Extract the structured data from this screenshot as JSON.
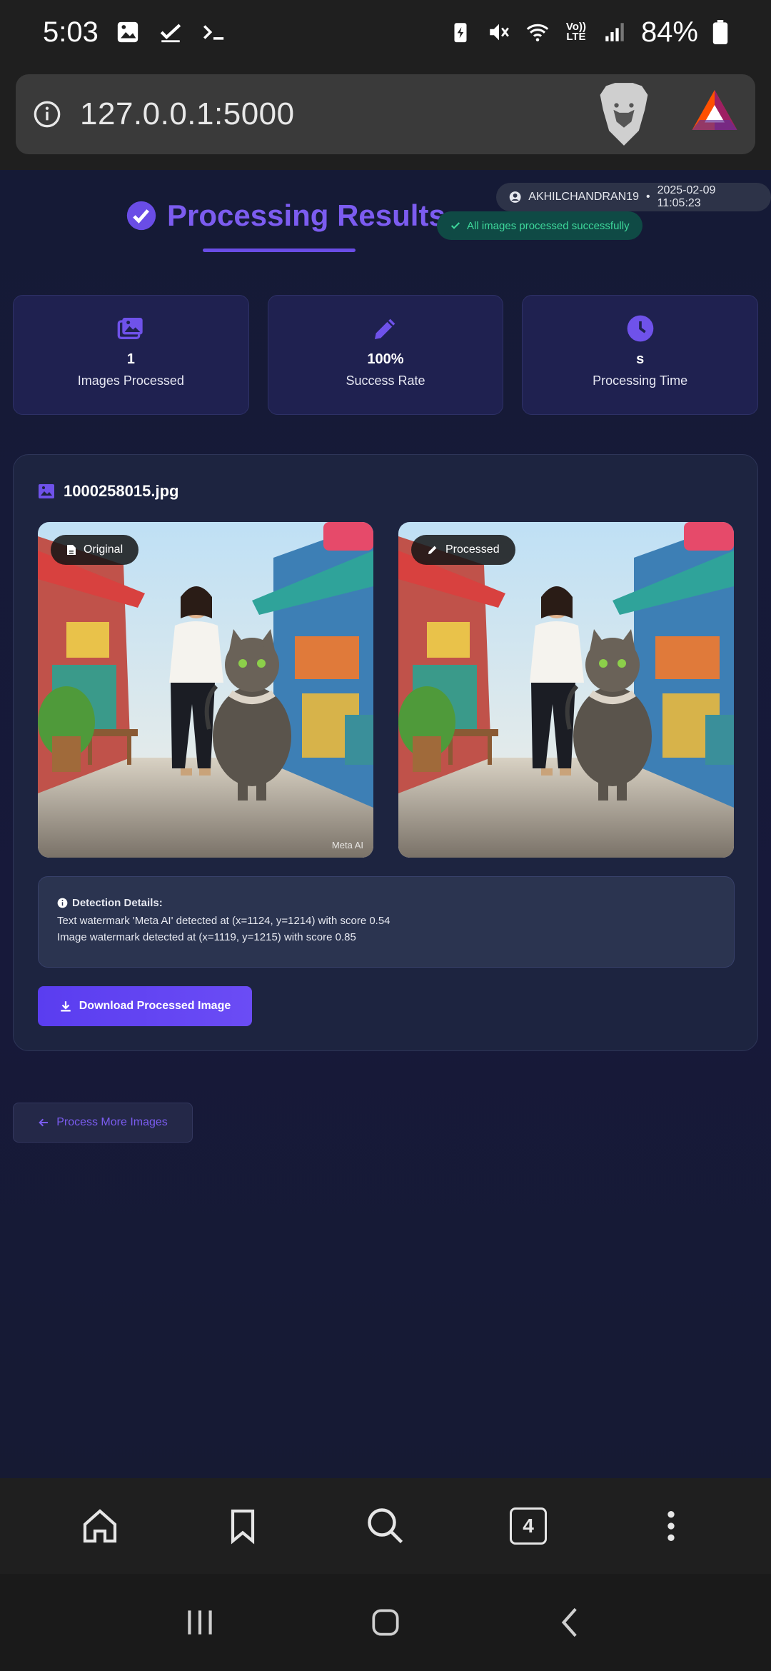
{
  "status_bar": {
    "time": "5:03",
    "battery": "84%",
    "network_label": "Vo)) LTE"
  },
  "browser": {
    "url": "127.0.0.1:5000",
    "tab_count": "4"
  },
  "header": {
    "user": "AKHILCHANDRAN19",
    "separator": "•",
    "timestamp": "2025-02-09 11:05:23",
    "title": "Processing Results",
    "success_badge": "All images processed successfully"
  },
  "stats": [
    {
      "value": "1",
      "label": "Images Processed",
      "icon": "images-icon"
    },
    {
      "value": "100%",
      "label": "Success Rate",
      "icon": "pencil-icon"
    },
    {
      "value": "s",
      "label": "Processing Time",
      "icon": "clock-icon"
    }
  ],
  "result": {
    "filename": "1000258015.jpg",
    "original_label": "Original",
    "processed_label": "Processed",
    "watermark_text": "Meta AI",
    "details_title": "Detection Details:",
    "details": [
      "Text watermark 'Meta AI' detected at (x=1124, y=1214) with score 0.54",
      "Image watermark detected at (x=1119, y=1215) with score 0.85"
    ],
    "download_label": "Download Processed Image"
  },
  "footer": {
    "more_label": "Process More Images"
  },
  "colors": {
    "accent": "#7c5cf0",
    "success": "#3ed89b",
    "background": "#161a33"
  }
}
